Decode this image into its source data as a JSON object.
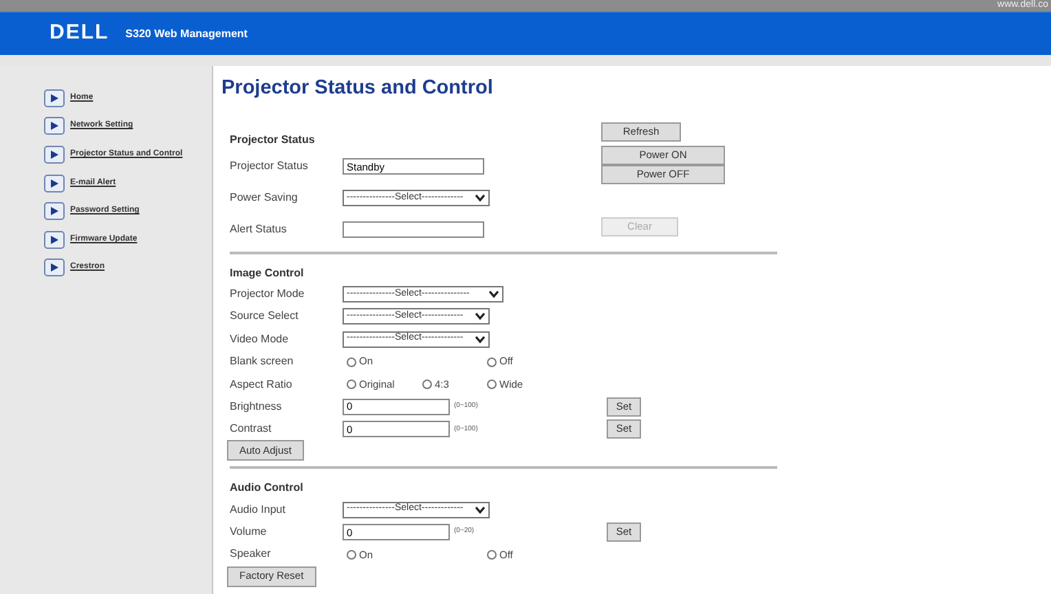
{
  "top_bar": {
    "url": "www.dell.co"
  },
  "header": {
    "logo": "DELL",
    "title": "S320 Web Management"
  },
  "sidebar": {
    "items": [
      {
        "label": "Home",
        "selected": false
      },
      {
        "label": "Network Setting",
        "selected": false
      },
      {
        "label": "Projector Status and Control",
        "selected": false
      },
      {
        "label": "E-mail Alert",
        "selected": false
      },
      {
        "label": "Password Setting",
        "selected": false
      },
      {
        "label": "Firmware Update",
        "selected": false
      },
      {
        "label": "Crestron",
        "selected": false
      }
    ]
  },
  "page_title": "Projector Status and Control",
  "projector_status": {
    "heading": "Projector Status",
    "rows": [
      {
        "kind": "text",
        "label": "Projector Status",
        "value": "Standby"
      },
      {
        "kind": "select",
        "label": "Power Saving",
        "value": "---------------Select-------------"
      },
      {
        "kind": "text",
        "label": "Alert Status",
        "value": ""
      }
    ],
    "buttons": [
      {
        "label": "Refresh",
        "disabled": false
      },
      {
        "label": "Power ON",
        "disabled": false
      },
      {
        "label": "Power OFF",
        "disabled": false
      },
      {
        "label": "Clear",
        "disabled": true
      }
    ]
  },
  "image_control": {
    "heading": "Image Control",
    "rows": [
      {
        "kind": "select",
        "label": "Projector Mode",
        "value": "---------------Select---------------"
      },
      {
        "kind": "select",
        "label": "Source Select",
        "value": "---------------Select-------------"
      },
      {
        "kind": "select",
        "label": "Video Mode",
        "value": "---------------Select-------------"
      },
      {
        "kind": "radio",
        "label": "Blank screen",
        "options": [
          {
            "label": "On",
            "selected": false
          },
          {
            "label": "Off",
            "selected": false
          }
        ]
      },
      {
        "kind": "radio",
        "label": "Aspect Ratio",
        "options": [
          {
            "label": "Original",
            "selected": false
          },
          {
            "label": "4:3",
            "selected": false
          },
          {
            "label": "Wide",
            "selected": false
          }
        ]
      },
      {
        "kind": "number",
        "label": "Brightness",
        "value": "0",
        "range": "(0~100)",
        "button": "Set"
      },
      {
        "kind": "number",
        "label": "Contrast",
        "value": "0",
        "range": "(0~100)",
        "button": "Set"
      }
    ],
    "button": "Auto Adjust"
  },
  "audio_control": {
    "heading": "Audio Control",
    "rows": [
      {
        "kind": "select",
        "label": "Audio Input",
        "value": "---------------Select-------------"
      },
      {
        "kind": "number",
        "label": "Volume",
        "value": "0",
        "range": "(0~20)",
        "button": "Set"
      },
      {
        "kind": "radio",
        "label": "Speaker",
        "options": [
          {
            "label": "On",
            "selected": false
          },
          {
            "label": "Off",
            "selected": false
          }
        ]
      }
    ],
    "button": "Factory Reset"
  }
}
